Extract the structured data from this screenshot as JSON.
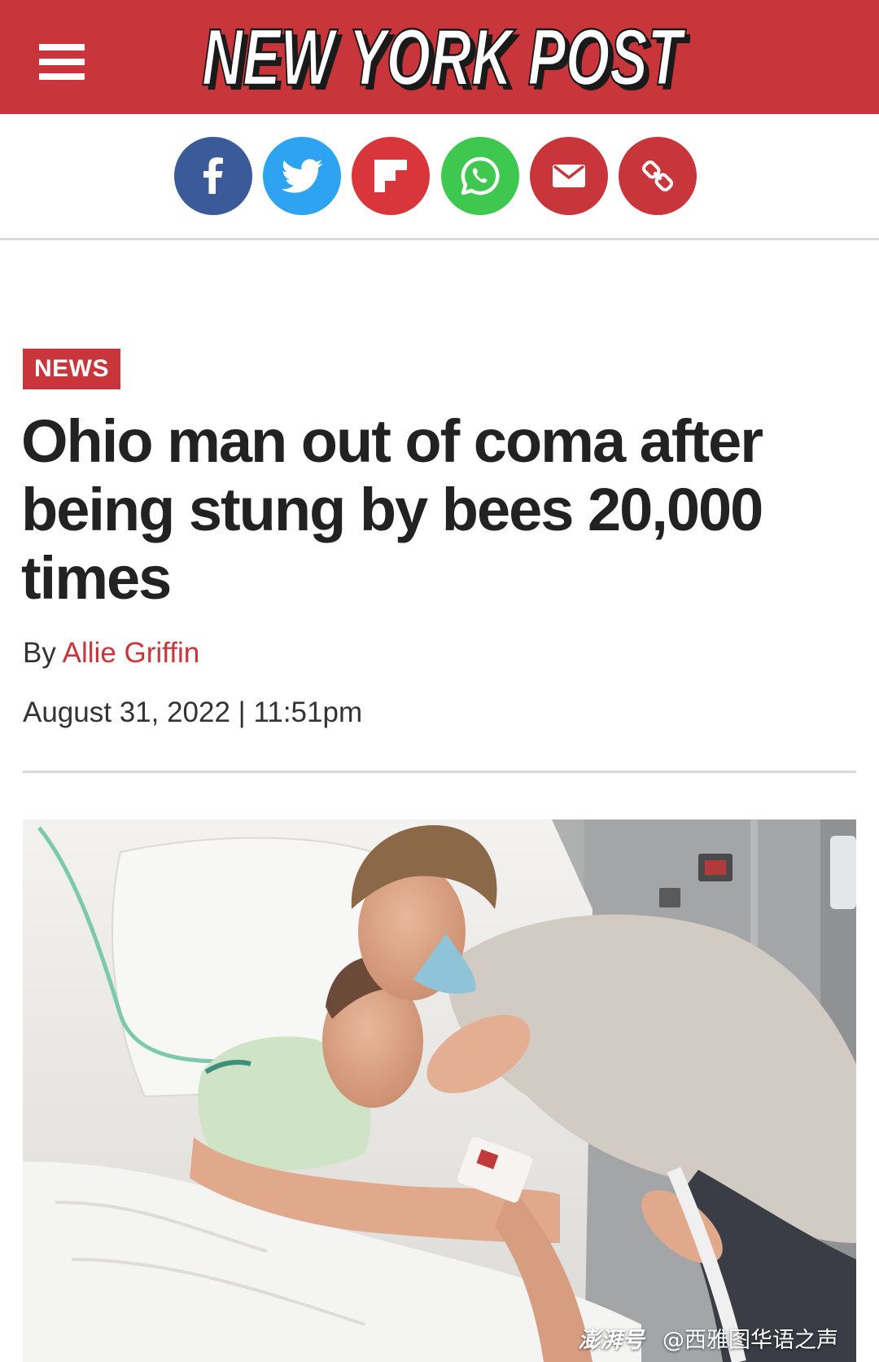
{
  "header": {
    "menu_icon": "hamburger-menu-icon",
    "logo_text": "NEW YORK POST",
    "background_color": "#c8353b"
  },
  "share": [
    {
      "network": "facebook",
      "icon": "facebook-icon",
      "color": "#3b5a9a"
    },
    {
      "network": "twitter",
      "icon": "twitter-icon",
      "color": "#2ea3f2"
    },
    {
      "network": "flipboard",
      "icon": "flipboard-icon",
      "color": "#d8363a"
    },
    {
      "network": "whatsapp",
      "icon": "whatsapp-icon",
      "color": "#3fc850"
    },
    {
      "network": "email",
      "icon": "email-icon",
      "color": "#c8353b"
    },
    {
      "network": "copy-link",
      "icon": "link-icon",
      "color": "#c8353b"
    }
  ],
  "article": {
    "section_badge": "NEWS",
    "headline": "Ohio man out of coma after being stung by bees 20,000 times",
    "byline_prefix": "By",
    "author": "Allie Griffin",
    "date": "August 31, 2022",
    "date_separator": "|",
    "time": "11:51pm"
  },
  "photo": {
    "watermark_brand": "澎湃号",
    "watermark_account": "@西雅图华语之声"
  }
}
